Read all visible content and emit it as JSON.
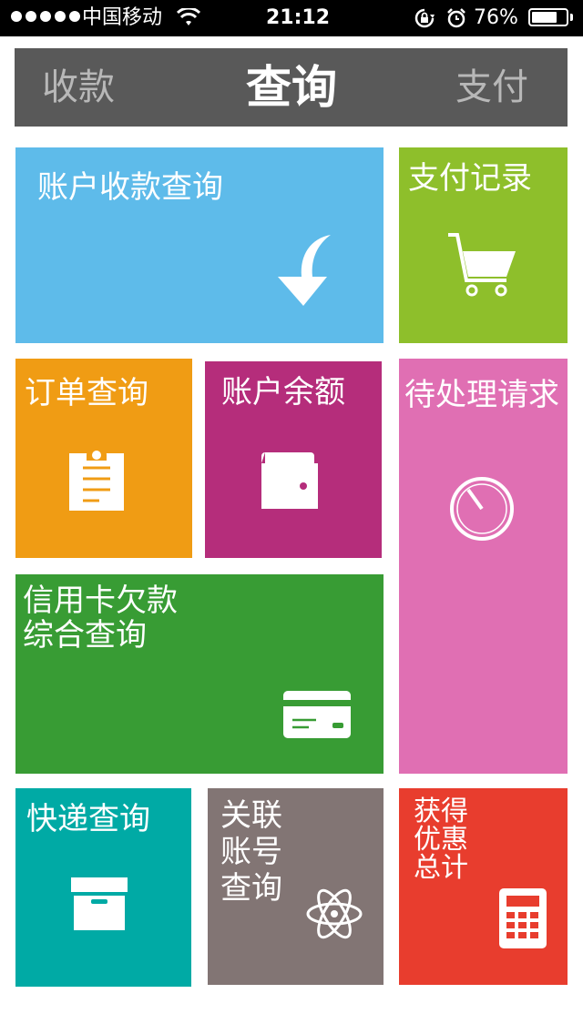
{
  "status_bar": {
    "carrier": "中国移动",
    "time": "21:12",
    "battery": "76%",
    "battery_level": 0.76,
    "icons": [
      "signal-dots-icon",
      "wifi-icon",
      "rotation-lock-icon",
      "alarm-icon",
      "battery-icon"
    ]
  },
  "segments": {
    "left": "收款",
    "center": "查询",
    "right": "支付",
    "active": "center"
  },
  "tiles": {
    "account_receipt": {
      "label": "账户收款查询",
      "color": "#5ebbea",
      "icon": "arrow-down-icon"
    },
    "payment_records": {
      "label": "支付记录",
      "color": "#8ebf2b",
      "icon": "shopping-cart-icon"
    },
    "order_query": {
      "label": "订单查询",
      "color": "#f09c14",
      "icon": "clipboard-icon"
    },
    "account_balance": {
      "label": "账户余额",
      "color": "#b52d7b",
      "icon": "wallet-icon"
    },
    "pending_requests": {
      "label": "待处理请求",
      "color": "#e06fb3",
      "icon": "timer-icon"
    },
    "credit_card": {
      "label": "信用卡欠款\n综合查询",
      "color": "#389c34",
      "icon": "credit-card-icon"
    },
    "express_query": {
      "label": "快递查询",
      "color": "#00aaa5",
      "icon": "box-icon"
    },
    "linked_accounts": {
      "label": "关联\n账号\n查询",
      "color": "#827574",
      "icon": "atom-icon"
    },
    "discounts": {
      "label": "获得\n优惠\n总计",
      "color": "#e83d2e",
      "icon": "calculator-icon"
    }
  }
}
